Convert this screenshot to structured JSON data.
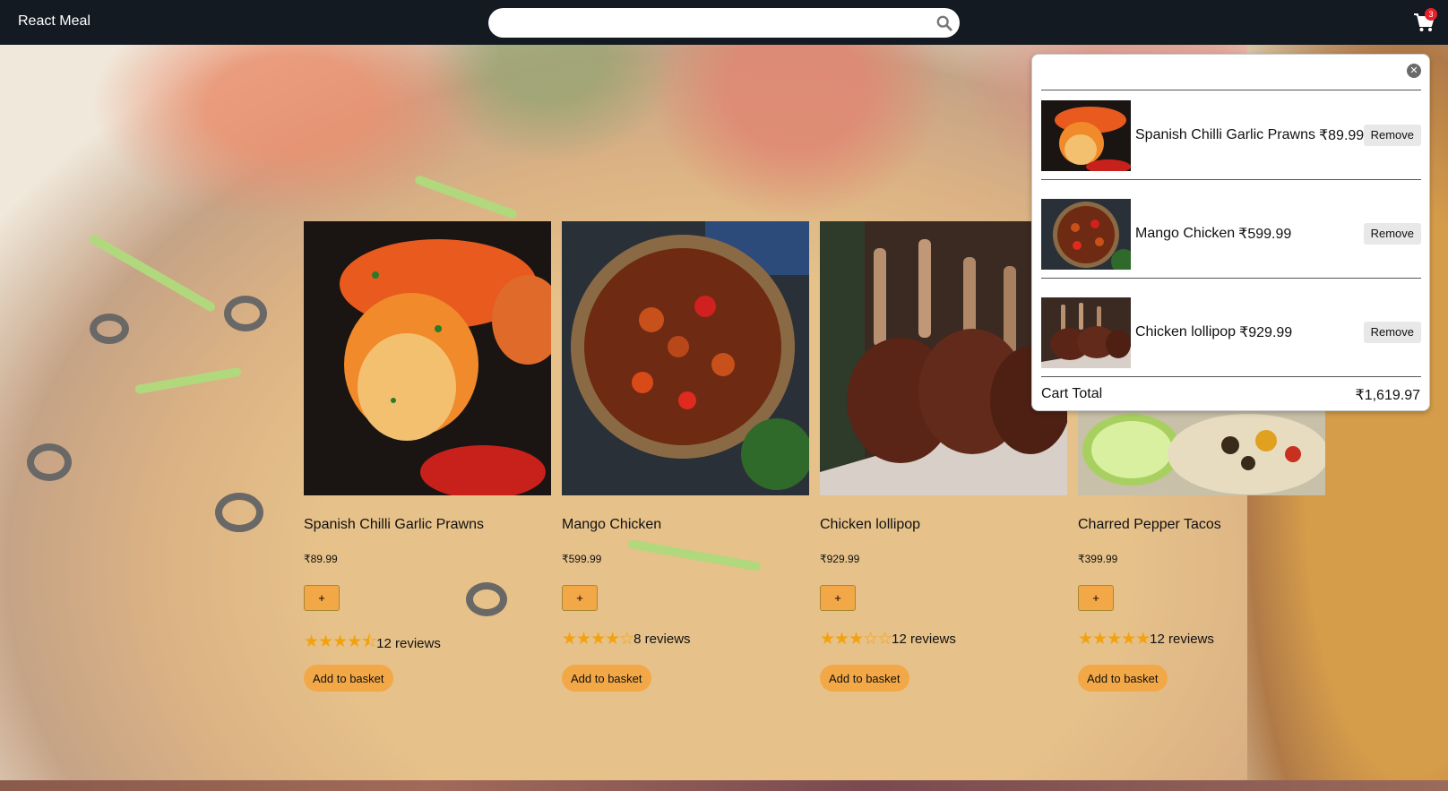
{
  "header": {
    "brand": "React Meal",
    "search": {
      "placeholder": "",
      "value": ""
    },
    "cart_count": "3"
  },
  "products": [
    {
      "name": "Spanish Chilli Garlic Prawns",
      "price": "₹89.99",
      "plus_label": "+",
      "rating": 4.5,
      "stars": "★★★★⯪",
      "reviews": "12 reviews",
      "add_label": "Add to basket"
    },
    {
      "name": "Mango Chicken",
      "price": "₹599.99",
      "plus_label": "+",
      "rating": 4,
      "stars": "★★★★☆",
      "reviews": "8 reviews",
      "add_label": "Add to basket"
    },
    {
      "name": "Chicken lollipop",
      "price": "₹929.99",
      "plus_label": "+",
      "rating": 3,
      "stars": "★★★☆☆",
      "reviews": "12 reviews",
      "add_label": "Add to basket"
    },
    {
      "name": "Charred Pepper Tacos",
      "price": "₹399.99",
      "plus_label": "+",
      "rating": 5,
      "stars": "★★★★★",
      "reviews": "12 reviews",
      "add_label": "Add to basket"
    }
  ],
  "cart": {
    "close_label": "✕",
    "items": [
      {
        "title": "Spanish Chilli Garlic Prawns",
        "price": "₹89.99",
        "remove_label": "Remove"
      },
      {
        "title": "Mango Chicken",
        "price": "₹599.99",
        "remove_label": "Remove"
      },
      {
        "title": "Chicken lollipop",
        "price": "₹929.99",
        "remove_label": "Remove"
      }
    ],
    "total_label": "Cart Total",
    "total_value": "₹1,619.97"
  },
  "colors": {
    "header": "#131a22",
    "accent": "#f3a847",
    "star": "#f3a20f",
    "badge": "#e8202a"
  },
  "icons": {
    "search": "search-icon",
    "cart": "cart-icon",
    "close": "close-icon"
  }
}
